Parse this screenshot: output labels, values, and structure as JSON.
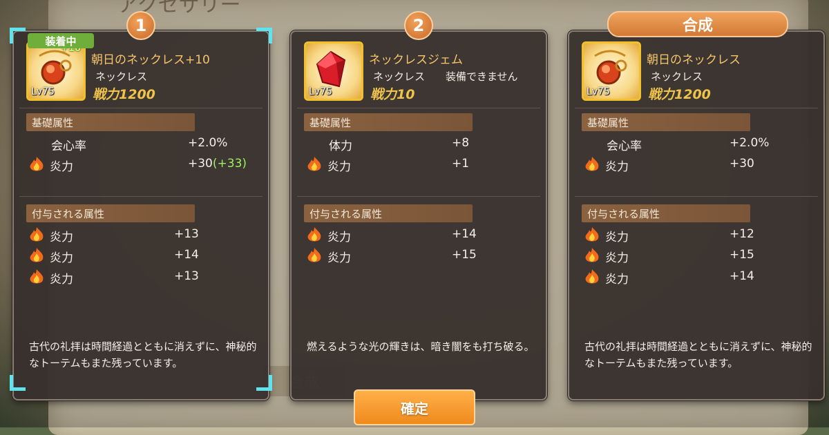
{
  "colors": {
    "accent": "#f08a1c",
    "gold": "#f0c34a",
    "equipped": "#6fae3a",
    "bonus": "#9ff060",
    "cyan": "#5fe3ef"
  },
  "background": {
    "title": "アクセサリー",
    "button": "合成"
  },
  "panels": [
    {
      "badge": "1",
      "equipped_label": "装着中",
      "plus_label": "+10",
      "level": "Lv75",
      "name": "朝日のネックレス+10",
      "type": "ネックレス",
      "power": "戦力1200",
      "base_title": "基礎属性",
      "base": [
        {
          "icon": "none",
          "label": "会心率",
          "value": "+2.0%",
          "bonus": ""
        },
        {
          "icon": "fire-icon",
          "label": "炎力",
          "value": "+30",
          "bonus": "(+33)"
        }
      ],
      "extra_title": "付与される属性",
      "extra": [
        {
          "label": "炎力",
          "value": "+13"
        },
        {
          "label": "炎力",
          "value": "+14"
        },
        {
          "label": "炎力",
          "value": "+13"
        }
      ],
      "desc": "古代の礼拝は時間経過とともに消えずに、神秘的なトーテムもまた残っています。"
    },
    {
      "badge": "2",
      "level": "Lv75",
      "name": "ネックレスジェム",
      "type": "ネックレス　　装備できません",
      "power": "戦力10",
      "base_title": "基礎属性",
      "base": [
        {
          "icon": "none",
          "label": "体力",
          "value": "+8",
          "bonus": ""
        },
        {
          "icon": "fire-icon",
          "label": "炎力",
          "value": "+1",
          "bonus": ""
        }
      ],
      "extra_title": "付与される属性",
      "extra": [
        {
          "label": "炎力",
          "value": "+14"
        },
        {
          "label": "炎力",
          "value": "+15"
        }
      ],
      "desc": "燃えるような光の輝きは、暗き闇をも打ち破る。"
    },
    {
      "tab": "合成",
      "level": "Lv75",
      "name": "朝日のネックレス",
      "type": "ネックレス",
      "power": "戦力1200",
      "base_title": "基礎属性",
      "base": [
        {
          "icon": "none",
          "label": "会心率",
          "value": "+2.0%",
          "bonus": ""
        },
        {
          "icon": "fire-icon",
          "label": "炎力",
          "value": "+30",
          "bonus": ""
        }
      ],
      "extra_title": "付与される属性",
      "extra": [
        {
          "label": "炎力",
          "value": "+12"
        },
        {
          "label": "炎力",
          "value": "+15"
        },
        {
          "label": "炎力",
          "value": "+14"
        }
      ],
      "desc": "古代の礼拝は時間経過とともに消えずに、神秘的なトーテムもまた残っています。"
    }
  ],
  "confirm_label": "確定"
}
